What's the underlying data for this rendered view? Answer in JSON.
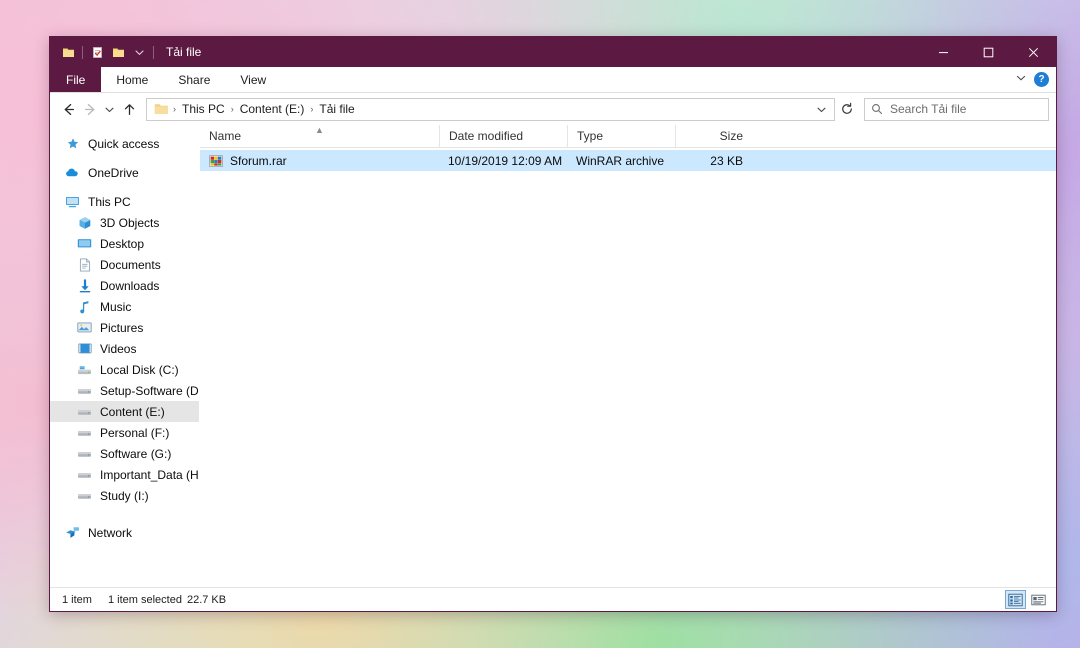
{
  "window": {
    "title": "Tải file",
    "accent_color": "#5c1a42",
    "selection_color": "#cce8ff",
    "sidebar_selected_color": "#e5e5e5"
  },
  "quick_access_toolbar": {
    "items": [
      {
        "name": "properties-folder-icon",
        "label": "Properties"
      },
      {
        "name": "properties-icon",
        "label": "Properties"
      },
      {
        "name": "new-folder-icon",
        "label": "New folder"
      },
      {
        "name": "customize-qat-chevron-icon",
        "label": "Customize Quick Access Toolbar"
      }
    ]
  },
  "window_controls": {
    "minimize": "Minimize",
    "maximize": "Maximize",
    "close": "Close"
  },
  "ribbon": {
    "tabs": [
      {
        "label": "File",
        "active": true
      },
      {
        "label": "Home",
        "active": false
      },
      {
        "label": "Share",
        "active": false
      },
      {
        "label": "View",
        "active": false
      }
    ],
    "collapse_label": "Minimize the Ribbon",
    "help_label": "?"
  },
  "navigation": {
    "back": "Back",
    "forward": "Forward",
    "recent": "Recent locations",
    "up": "Up"
  },
  "address_bar": {
    "crumbs": [
      "This PC",
      "Content (E:)",
      "Tải file"
    ],
    "separator": "›",
    "dropdown_label": "Previous locations",
    "refresh_label": "Refresh"
  },
  "search": {
    "placeholder": "Search Tải file"
  },
  "sidebar": {
    "groups": [
      {
        "items": [
          {
            "label": "Quick access",
            "icon": "star-icon",
            "level": 0,
            "selected": false
          }
        ]
      },
      {
        "items": [
          {
            "label": "OneDrive",
            "icon": "cloud-icon",
            "level": 0,
            "selected": false
          }
        ]
      },
      {
        "items": [
          {
            "label": "This PC",
            "icon": "monitor-icon",
            "level": 0,
            "selected": false
          },
          {
            "label": "3D Objects",
            "icon": "cube-icon",
            "level": 1,
            "selected": false
          },
          {
            "label": "Desktop",
            "icon": "desktop-icon",
            "level": 1,
            "selected": false
          },
          {
            "label": "Documents",
            "icon": "document-icon",
            "level": 1,
            "selected": false
          },
          {
            "label": "Downloads",
            "icon": "download-arrow-icon",
            "level": 1,
            "selected": false
          },
          {
            "label": "Music",
            "icon": "music-note-icon",
            "level": 1,
            "selected": false
          },
          {
            "label": "Pictures",
            "icon": "picture-icon",
            "level": 1,
            "selected": false
          },
          {
            "label": "Videos",
            "icon": "video-icon",
            "level": 1,
            "selected": false
          },
          {
            "label": "Local Disk (C:)",
            "icon": "system-drive-icon",
            "level": 1,
            "selected": false
          },
          {
            "label": "Setup-Software (D:)",
            "icon": "drive-icon",
            "level": 1,
            "selected": false
          },
          {
            "label": "Content (E:)",
            "icon": "drive-icon",
            "level": 1,
            "selected": true
          },
          {
            "label": "Personal (F:)",
            "icon": "drive-icon",
            "level": 1,
            "selected": false
          },
          {
            "label": "Software (G:)",
            "icon": "drive-icon",
            "level": 1,
            "selected": false
          },
          {
            "label": "Important_Data (H:)",
            "icon": "drive-icon",
            "level": 1,
            "selected": false
          },
          {
            "label": "Study (I:)",
            "icon": "drive-icon",
            "level": 1,
            "selected": false
          }
        ]
      },
      {
        "items": [
          {
            "label": "Network",
            "icon": "network-icon",
            "level": 0,
            "selected": false
          }
        ]
      }
    ]
  },
  "file_list": {
    "columns": [
      {
        "label": "Name",
        "sorted": true,
        "sort_direction": "asc"
      },
      {
        "label": "Date modified",
        "sorted": false
      },
      {
        "label": "Type",
        "sorted": false
      },
      {
        "label": "Size",
        "sorted": false
      }
    ],
    "rows": [
      {
        "name": "Sforum.rar",
        "date_modified": "10/19/2019 12:09 AM",
        "type": "WinRAR archive",
        "size": "23 KB",
        "icon": "winrar-archive-icon",
        "selected": true
      }
    ]
  },
  "status_bar": {
    "item_count": "1 item",
    "selection_count": "1 item selected",
    "selection_size": "22.7 KB",
    "views": [
      {
        "name": "details-view-button",
        "label": "Details view",
        "active": true
      },
      {
        "name": "large-icons-view-button",
        "label": "Large icons view",
        "active": false
      }
    ]
  }
}
